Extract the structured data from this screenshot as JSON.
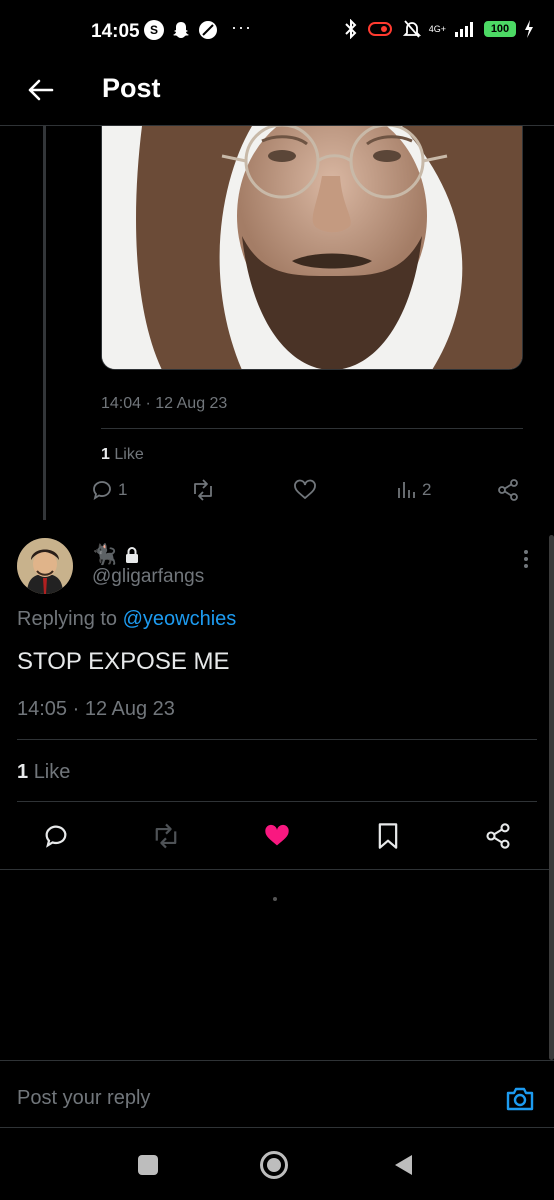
{
  "status_bar": {
    "time": "14:05",
    "left_icons": [
      "skype-icon",
      "snapchat-icon",
      "browser-icon"
    ],
    "more": "···",
    "network": "4G+",
    "battery": "100"
  },
  "header": {
    "title": "Post"
  },
  "parent_post": {
    "timestamp": "14:04 · 12 Aug 23",
    "likes_count": "1",
    "likes_label": "Like",
    "actions": {
      "reply_count": "1",
      "views_count": "2"
    }
  },
  "reply_post": {
    "display_name_emoji": "🐈‍⬛",
    "handle": "@gligarfangs",
    "replying_prefix": "Replying to",
    "replying_to": "@yeowchies",
    "text": "STOP EXPOSE ME",
    "timestamp": "14:05 · 12 Aug 23",
    "likes_count": "1",
    "likes_label": "Like",
    "liked": true
  },
  "composer": {
    "placeholder": "Post your reply"
  },
  "colors": {
    "accent": "#1d9bf0",
    "like": "#f91880",
    "muted": "#71767b",
    "divider": "#2f3336"
  }
}
